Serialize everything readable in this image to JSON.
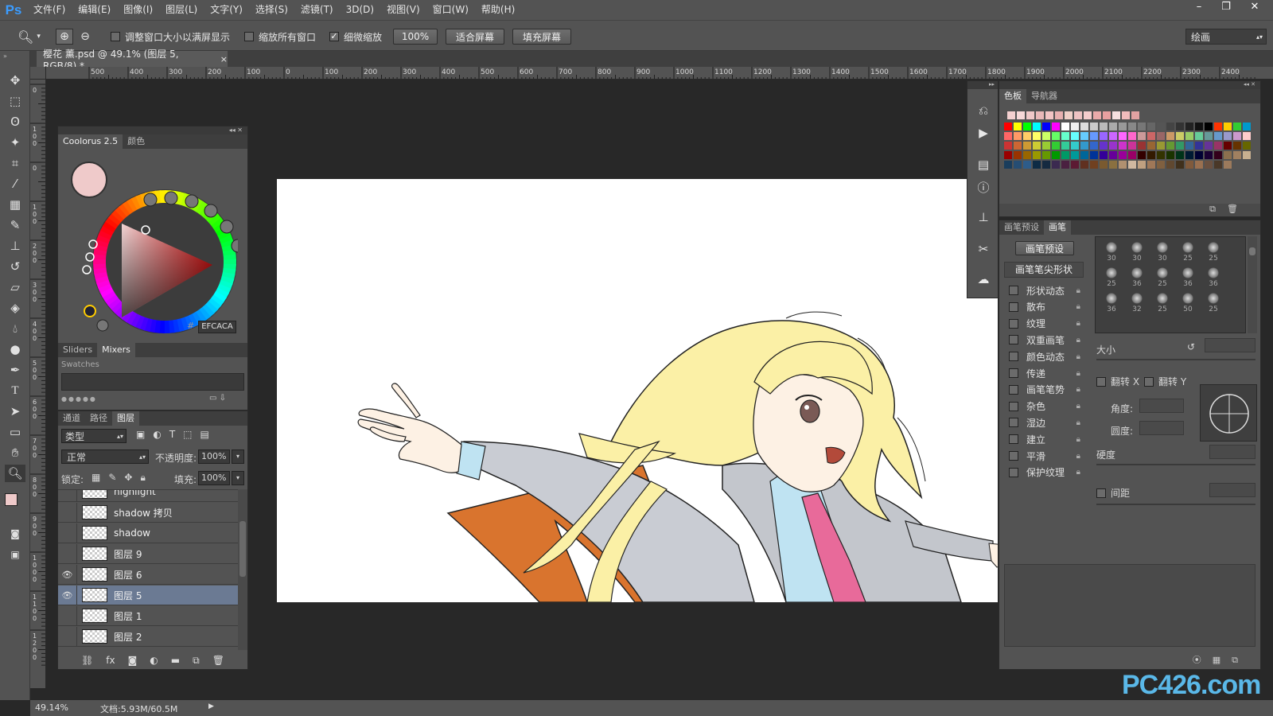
{
  "app": {
    "logo": "Ps"
  },
  "menu": [
    "文件(F)",
    "编辑(E)",
    "图像(I)",
    "图层(L)",
    "文字(Y)",
    "选择(S)",
    "滤镜(T)",
    "3D(D)",
    "视图(V)",
    "窗口(W)",
    "帮助(H)"
  ],
  "window_controls": {
    "minimize": "–",
    "restore": "❐",
    "close": "✕"
  },
  "options": {
    "resize_windows": "调整窗口大小以满屏显示",
    "zoom_all": "缩放所有窗口",
    "scrubby_zoom": "细微缩放",
    "zoom_value": "100%",
    "fit_screen": "适合屏幕",
    "fill_screen": "填充屏幕",
    "workspace": "绘画"
  },
  "document": {
    "tab_title": "樱花 薰.psd @ 49.1% (图层 5, RGB/8) *",
    "close": "×"
  },
  "ruler_h": [
    "500",
    "400",
    "300",
    "200",
    "100",
    "0",
    "100",
    "200",
    "300",
    "400",
    "500",
    "600",
    "700",
    "800",
    "900",
    "1000",
    "1100",
    "1200",
    "1300",
    "1400",
    "1500",
    "1600",
    "1700",
    "1800",
    "1900",
    "2000",
    "2100",
    "2200",
    "2300",
    "2400"
  ],
  "ruler_v": [
    "0",
    "1\n0\n0",
    "0",
    "1\n0\n0",
    "2\n0\n0",
    "3\n0\n0",
    "4\n0\n0",
    "5\n0\n0",
    "6\n0\n0",
    "7\n0\n0",
    "8\n0\n0",
    "9\n0\n0",
    "1\n0\n0\n0",
    "1\n1\n0\n0",
    "1\n2\n0\n0"
  ],
  "coolorus": {
    "tabs": [
      "Coolorus 2.5",
      "颜色"
    ],
    "hex": "EFCACA",
    "current_color": "#EFCACA",
    "bottom_tabs": [
      "Sliders",
      "Mixers"
    ],
    "swatches_label": "Swatches"
  },
  "layers_panel": {
    "tabs": [
      "通道",
      "路径",
      "图层"
    ],
    "filter_kind": "类型",
    "blend_mode": "正常",
    "opacity_label": "不透明度:",
    "opacity_value": "100%",
    "lock_label": "锁定:",
    "fill_label": "填充:",
    "fill_value": "100%",
    "layers": [
      {
        "name": "highlight",
        "visible": false,
        "selected": false
      },
      {
        "name": "shadow 拷贝",
        "visible": false,
        "selected": false
      },
      {
        "name": "shadow",
        "visible": false,
        "selected": false
      },
      {
        "name": "图层 9",
        "visible": false,
        "selected": false
      },
      {
        "name": "图层 6",
        "visible": true,
        "selected": false
      },
      {
        "name": "图层 5",
        "visible": true,
        "selected": true
      },
      {
        "name": "图层 1",
        "visible": false,
        "selected": false
      },
      {
        "name": "图层 2",
        "visible": false,
        "selected": false
      }
    ],
    "footer_icons": [
      "link-icon",
      "fx-icon",
      "mask-icon",
      "adjustment-icon",
      "folder-icon",
      "new-layer-icon",
      "trash-icon"
    ]
  },
  "swatches_panel": {
    "tabs": [
      "色板",
      "导航器"
    ]
  },
  "brush_panel": {
    "tabs": [
      "画笔预设",
      "画笔"
    ],
    "preset_button": "画笔预设",
    "tip_shape": "画笔笔尖形状",
    "options": [
      "形状动态",
      "散布",
      "纹理",
      "双重画笔",
      "颜色动态",
      "传递",
      "画笔笔势",
      "杂色",
      "湿边",
      "建立",
      "平滑",
      "保护纹理"
    ],
    "size_label": "大小",
    "flip_x": "翻转 X",
    "flip_y": "翻转 Y",
    "angle_label": "角度:",
    "roundness_label": "圆度:",
    "hardness_label": "硬度",
    "spacing_label": "间距",
    "tip_sizes": [
      "30",
      "30",
      "30",
      "25",
      "25",
      "25",
      "36",
      "25",
      "36",
      "36",
      "36",
      "32",
      "25",
      "50",
      "25"
    ]
  },
  "status": {
    "zoom": "49.14%",
    "doc_size": "文档:5.93M/60.5M"
  },
  "watermark": "PC426.com"
}
